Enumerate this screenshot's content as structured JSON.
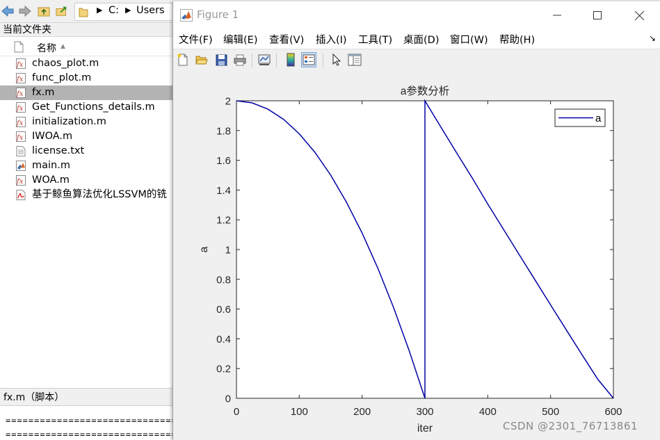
{
  "browser": {
    "path_drive": "C:",
    "path_folder": "Users",
    "current_folder_label": "当前文件夹",
    "column_name": "名称",
    "files": [
      {
        "name": "chaos_plot.m",
        "type": "func",
        "selected": false
      },
      {
        "name": "func_plot.m",
        "type": "func",
        "selected": false
      },
      {
        "name": "fx.m",
        "type": "func",
        "selected": true
      },
      {
        "name": "Get_Functions_details.m",
        "type": "func",
        "selected": false
      },
      {
        "name": "initialization.m",
        "type": "func",
        "selected": false
      },
      {
        "name": "IWOA.m",
        "type": "func",
        "selected": false
      },
      {
        "name": "license.txt",
        "type": "txt",
        "selected": false
      },
      {
        "name": "main.m",
        "type": "script",
        "selected": false
      },
      {
        "name": "WOA.m",
        "type": "func",
        "selected": false
      },
      {
        "name": "基于鲸鱼算法优化LSSVM的铣",
        "type": "pdf",
        "selected": false
      }
    ],
    "details_title": "fx.m（脚本）",
    "details_lines": [
      "================================",
      "================================"
    ]
  },
  "figure": {
    "window_title": "Figure 1",
    "menus": [
      "文件(F)",
      "编辑(E)",
      "查看(V)",
      "插入(I)",
      "工具(T)",
      "桌面(D)",
      "窗口(W)",
      "帮助(H)"
    ],
    "toolbar_icons": [
      "new-figure-icon",
      "open-file-icon",
      "save-icon",
      "print-icon",
      "link-plot-icon",
      "colorbar-icon",
      "legend-icon",
      "pointer-icon",
      "property-inspector-icon"
    ]
  },
  "chart_data": {
    "type": "line",
    "title": "a参数分析",
    "xlabel": "iter",
    "ylabel": "a",
    "xlim": [
      0,
      600
    ],
    "ylim": [
      0,
      2
    ],
    "x_ticks": [
      "0",
      "100",
      "200",
      "300",
      "400",
      "500",
      "600"
    ],
    "y_ticks": [
      "0",
      "0.2",
      "0.4",
      "0.6",
      "0.8",
      "1",
      "1.2",
      "1.4",
      "1.6",
      "1.8",
      "2"
    ],
    "grid": false,
    "legend_position": "top-right",
    "series": [
      {
        "name": "a",
        "color": "#0000a6",
        "x": [
          0,
          25,
          50,
          75,
          100,
          125,
          150,
          175,
          200,
          225,
          250,
          275,
          300,
          300,
          325,
          350,
          375,
          400,
          425,
          450,
          475,
          500,
          525,
          550,
          575,
          600
        ],
        "y": [
          2.0,
          1.986,
          1.944,
          1.875,
          1.778,
          1.653,
          1.5,
          1.319,
          1.111,
          0.875,
          0.611,
          0.319,
          0.0,
          2.0,
          1.826,
          1.653,
          1.483,
          1.306,
          1.136,
          0.966,
          0.797,
          0.628,
          0.46,
          0.293,
          0.129,
          0.0
        ]
      }
    ]
  },
  "watermark": "CSDN @2301_76713861"
}
